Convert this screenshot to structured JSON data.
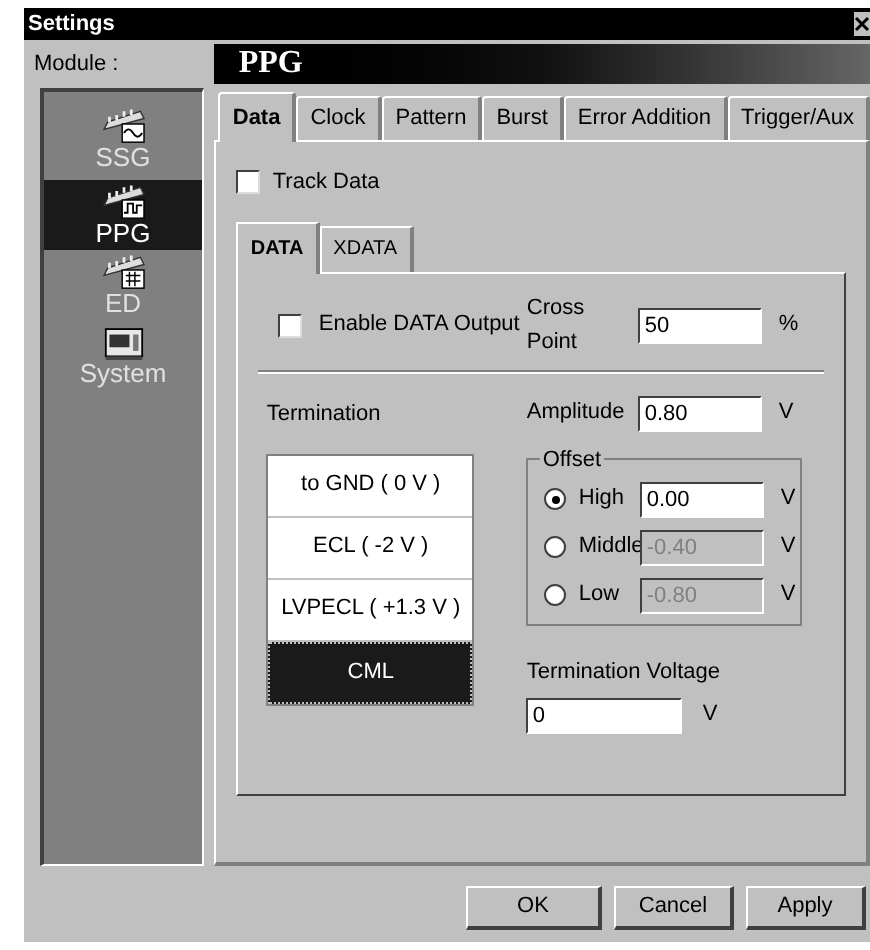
{
  "window": {
    "title": "Settings"
  },
  "module_label": "Module :",
  "modules": [
    {
      "label": "SSG",
      "selected": false
    },
    {
      "label": "PPG",
      "selected": true
    },
    {
      "label": "ED",
      "selected": false
    },
    {
      "label": "System",
      "selected": false
    }
  ],
  "panel_title": "PPG",
  "tabs": [
    {
      "label": "Data",
      "selected": true
    },
    {
      "label": "Clock",
      "selected": false
    },
    {
      "label": "Pattern",
      "selected": false
    },
    {
      "label": "Burst",
      "selected": false
    },
    {
      "label": "Error Addition",
      "selected": false
    },
    {
      "label": "Trigger/Aux",
      "selected": false
    }
  ],
  "track_data": {
    "label": "Track Data",
    "checked": false
  },
  "subtabs": [
    {
      "label": "DATA",
      "selected": true
    },
    {
      "label": "XDATA",
      "selected": false
    }
  ],
  "enable_output": {
    "label": "Enable DATA Output",
    "checked": false
  },
  "cross_point": {
    "label": "Cross Point",
    "value": "50",
    "unit": "%"
  },
  "termination": {
    "label": "Termination",
    "options": [
      {
        "label": "to GND ( 0 V )",
        "selected": false
      },
      {
        "label": "ECL ( -2 V )",
        "selected": false
      },
      {
        "label": "LVPECL ( +1.3 V )",
        "selected": false
      },
      {
        "label": "CML",
        "selected": true
      }
    ]
  },
  "amplitude": {
    "label": "Amplitude",
    "value": "0.80",
    "unit": "V"
  },
  "offset": {
    "title": "Offset",
    "options": [
      {
        "label": "High",
        "value": "0.00",
        "unit": "V",
        "selected": true,
        "disabled": false
      },
      {
        "label": "Middle",
        "value": "-0.40",
        "unit": "V",
        "selected": false,
        "disabled": true
      },
      {
        "label": "Low",
        "value": "-0.80",
        "unit": "V",
        "selected": false,
        "disabled": true
      }
    ]
  },
  "termination_voltage": {
    "label": "Termination Voltage",
    "value": "0",
    "unit": "V"
  },
  "buttons": [
    "OK",
    "Cancel",
    "Apply"
  ]
}
